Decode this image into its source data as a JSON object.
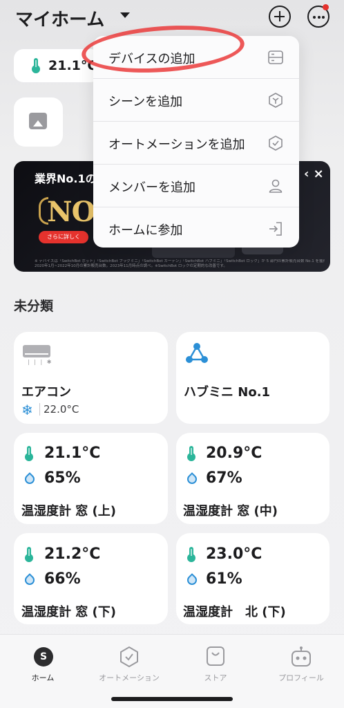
{
  "header": {
    "title": "マイホーム",
    "add_icon": "plus-circle-icon",
    "more_icon": "ellipsis-circle-icon",
    "notification_color": "#e5322d"
  },
  "weather": {
    "temperature": "21.1°C"
  },
  "banner": {
    "title": "業界No.1の",
    "badge": "NO.1",
    "button_label": "さらに詳しく",
    "close_glyph": "‹ ×",
    "fine_print_1": "※ デバイスは「SwitchBot ボット」「SwitchBot プラグミニ」「SwitchBot カーテン」「SwitchBot ハブミニ」「SwitchBot ロック」が 5 部門の累計販売台数 No.1 を獲得しました。",
    "fine_print_2": "2020年1月~2022年10月の累計販売台数。2023年11月時点の調べ。※SwitchBot ロックの定期的な改善です。"
  },
  "menu": {
    "items": [
      {
        "label": "デバイスの追加",
        "icon": "device-icon"
      },
      {
        "label": "シーンを追加",
        "icon": "scene-icon"
      },
      {
        "label": "オートメーションを追加",
        "icon": "automation-icon"
      },
      {
        "label": "メンバーを追加",
        "icon": "member-icon"
      },
      {
        "label": "ホームに参加",
        "icon": "join-home-icon"
      }
    ]
  },
  "section": {
    "title": "未分類"
  },
  "devices": {
    "aircon": {
      "name": "エアコン",
      "temp": "22.0°C"
    },
    "hub": {
      "name": "ハブミニ No.1"
    },
    "meter1": {
      "name": "温湿度計 窓 (上)",
      "temp": "21.1°C",
      "humidity": "65%"
    },
    "meter2": {
      "name": "温湿度計 窓 (中)",
      "temp": "20.9°C",
      "humidity": "67%"
    },
    "meter3": {
      "name": "温湿度計 窓 (下)",
      "temp": "21.2°C",
      "humidity": "66%"
    },
    "meter4": {
      "name": "温湿度計　北 (下)",
      "temp": "23.0°C",
      "humidity": "61%"
    }
  },
  "tabbar": {
    "home": "ホーム",
    "automation": "オートメーション",
    "store": "ストア",
    "profile": "プロフィール",
    "home_glyph": "S"
  },
  "colors": {
    "accent_teal": "#2bb59a",
    "accent_blue": "#2b8fd6",
    "annotation_red": "#ea3b3b"
  }
}
